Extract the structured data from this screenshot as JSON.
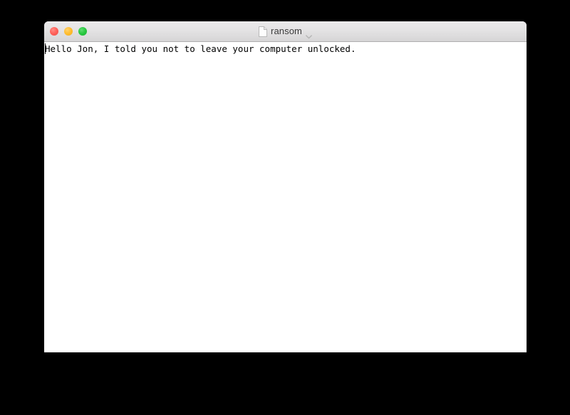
{
  "window": {
    "title": "ransom",
    "title_icon": "document-page-icon",
    "title_chevron": "chevron-down-icon",
    "controls": {
      "close_label": "close",
      "minimize_label": "minimize",
      "zoom_label": "zoom",
      "close_color": "#ff6159",
      "minimize_color": "#ffbd2e",
      "zoom_color": "#28c840"
    }
  },
  "document": {
    "text": "Hello Jon, I told you not to leave your computer unlocked.",
    "caret_visible": true
  },
  "desktop": {
    "background_color": "#000000"
  }
}
